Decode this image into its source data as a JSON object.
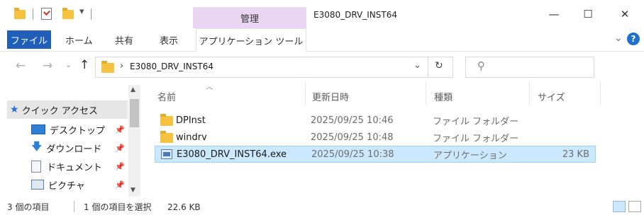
{
  "window": {
    "manage_label": "管理",
    "title": "E3080_DRV_INST64",
    "minimize": "—",
    "maximize": "☐",
    "close": "✕"
  },
  "ribbon": {
    "tabs": [
      "ファイル",
      "ホーム",
      "共有",
      "表示",
      "アプリケーション ツール"
    ],
    "expand_glyph": "⌄",
    "help_glyph": "?"
  },
  "address": {
    "path_sep": "›",
    "path": "E3080_DRV_INST64",
    "dropdown_glyph": "⌄",
    "refresh_glyph": "↻",
    "search_glyph": "⚲",
    "search_placeholder": ""
  },
  "nav_pane": {
    "quick_access": "クイック アクセス",
    "items": [
      "デスクトップ",
      "ダウンロード",
      "ドキュメント",
      "ピクチャ"
    ]
  },
  "file_list": {
    "columns": {
      "name": "名前",
      "date": "更新日時",
      "type": "種類",
      "size": "サイズ"
    },
    "rows": [
      {
        "name": "DPInst",
        "date": "2025/09/25 10:46",
        "type": "ファイル フォルダー",
        "size": ""
      },
      {
        "name": "windrv",
        "date": "2025/09/25 10:48",
        "type": "ファイル フォルダー",
        "size": ""
      },
      {
        "name": "E3080_DRV_INST64.exe",
        "date": "2025/09/25 10:38",
        "type": "アプリケーション",
        "size": "23 KB"
      }
    ]
  },
  "status_bar": {
    "item_count": "3 個の項目",
    "selected": "1 個の項目を選択",
    "selected_size": "22.6 KB"
  },
  "colors": {
    "accent": "#1f5fb8",
    "manage_tab": "#ead6f3",
    "selection": "#cce8ff",
    "folder": "#f5c242"
  }
}
